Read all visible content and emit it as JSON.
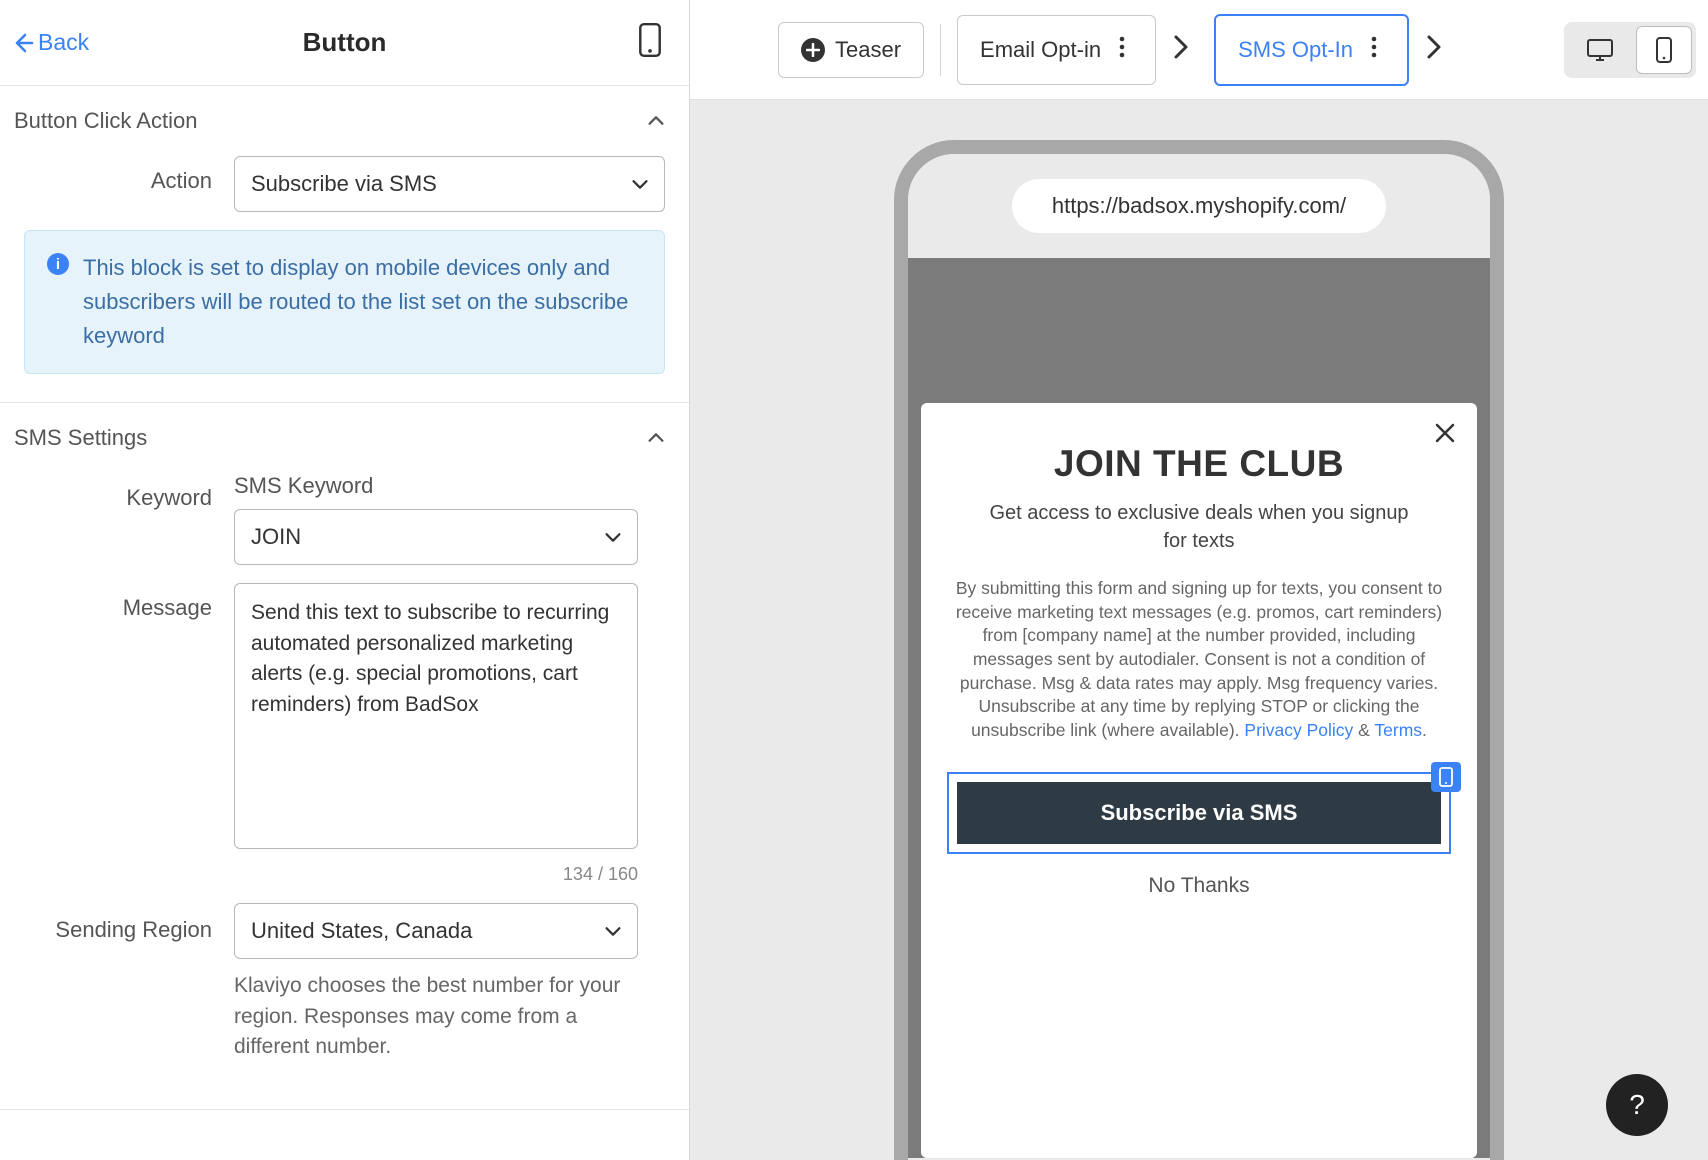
{
  "panel": {
    "back": "Back",
    "title": "Button"
  },
  "sections": {
    "click_action": {
      "title": "Button Click Action",
      "action_label": "Action",
      "action_value": "Subscribe via SMS",
      "info": "This block is set to display on mobile devices only and subscribers will be routed to the list set on the subscribe keyword"
    },
    "sms": {
      "title": "SMS Settings",
      "keyword_label": "Keyword",
      "keyword_sub": "SMS Keyword",
      "keyword_value": "JOIN",
      "message_label": "Message",
      "message_value": "Send this text to subscribe to recurring automated personalized marketing alerts (e.g. special promotions, cart reminders) from BadSox",
      "char_count": "134 / 160",
      "region_label": "Sending Region",
      "region_value": "United States, Canada",
      "region_help": "Klaviyo chooses the best number for your region. Responses may come from a different number."
    }
  },
  "toolbar": {
    "teaser": "Teaser",
    "email_optin": "Email Opt-in",
    "sms_optin": "SMS Opt-In"
  },
  "preview": {
    "url": "https://badsox.myshopify.com/",
    "popup": {
      "title": "JOIN THE CLUB",
      "subtitle": "Get access to exclusive deals when you signup for texts",
      "legal_pre": "By submitting this form and signing up for texts, you consent to receive marketing text messages (e.g. promos, cart reminders) from [company name] at the number provided, including messages sent by autodialer. Consent is not a condition of purchase. Msg & data rates may apply. Msg frequency varies. Unsubscribe at any time by replying STOP or clicking the unsubscribe link (where available). ",
      "privacy": "Privacy Policy",
      "amp": " & ",
      "terms": "Terms",
      "period": ".",
      "cta": "Subscribe via SMS",
      "no_thanks": "No Thanks"
    }
  },
  "help": "?"
}
